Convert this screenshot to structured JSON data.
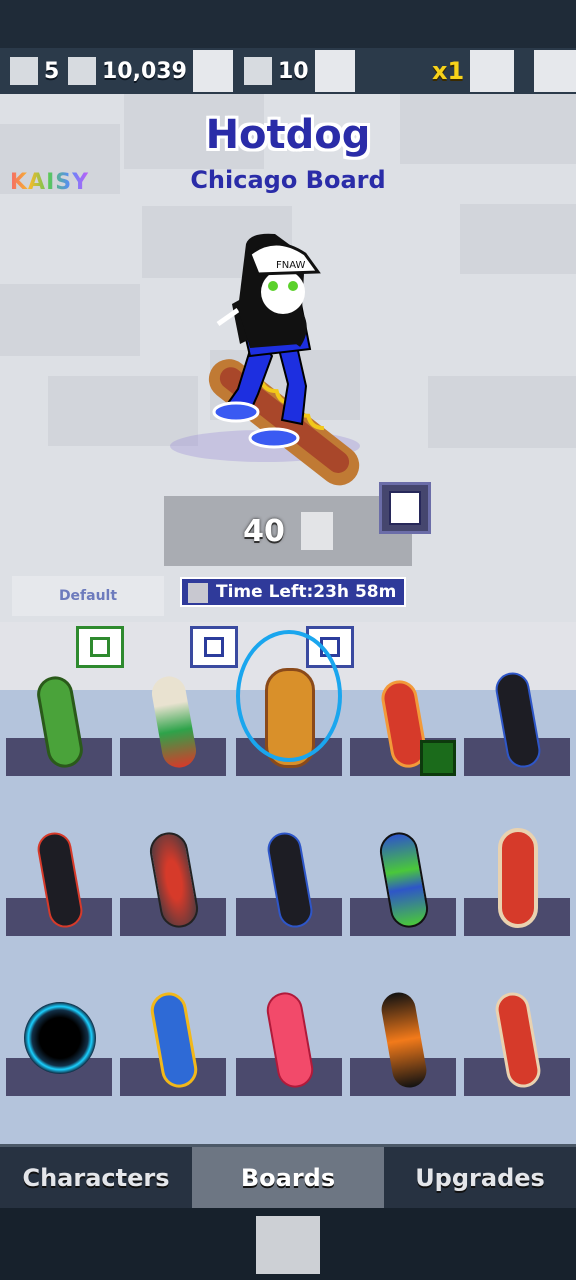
{
  "hud": {
    "lives": "5",
    "coins": "10,039",
    "keys": "10",
    "multiplier": "x1"
  },
  "stage": {
    "logo": "KAISY",
    "title": "Hotdog",
    "subtitle": "Chicago Board",
    "price": "40",
    "default_label": "Default",
    "time_left": "Time Left:23h 58m"
  },
  "boards": [
    {
      "name": "star-board",
      "color": "#4aa33a",
      "accent": "#f2d21a"
    },
    {
      "name": "soccer-board",
      "color": "#e9e2d0",
      "accent": "#2ea34a"
    },
    {
      "name": "hotdog-board",
      "color": "#d9902a",
      "accent": "#fff2a0"
    },
    {
      "name": "red-board",
      "color": "#d63a2a",
      "accent": "#f29a3a"
    },
    {
      "name": "black-board",
      "color": "#1d1d24",
      "accent": "#2e56c8"
    },
    {
      "name": "black-red-board",
      "color": "#1d1d24",
      "accent": "#d63a2a"
    },
    {
      "name": "hoverboard-red",
      "color": "#6a6a72",
      "accent": "#d63a2a"
    },
    {
      "name": "black-blue-board",
      "color": "#1d1d24",
      "accent": "#2e56c8"
    },
    {
      "name": "hoverboard-blue",
      "color": "#2e56c8",
      "accent": "#4ac83a"
    },
    {
      "name": "rocket-board",
      "color": "#d63a2a",
      "accent": "#e9d2b0"
    },
    {
      "name": "portal-board",
      "color": "#123048",
      "accent": "#1ad0ff"
    },
    {
      "name": "bam-board",
      "color": "#2e6ad6",
      "accent": "#f2b81a"
    },
    {
      "name": "pink-board",
      "color": "#f24a6a",
      "accent": "#d63a2a"
    },
    {
      "name": "flame-board",
      "color": "#121212",
      "accent": "#f27a1a"
    },
    {
      "name": "carrot-board",
      "color": "#d63a2a",
      "accent": "#4ac83a"
    }
  ],
  "tabs": [
    {
      "label": "Characters"
    },
    {
      "label": "Boards"
    },
    {
      "label": "Upgrades"
    }
  ]
}
